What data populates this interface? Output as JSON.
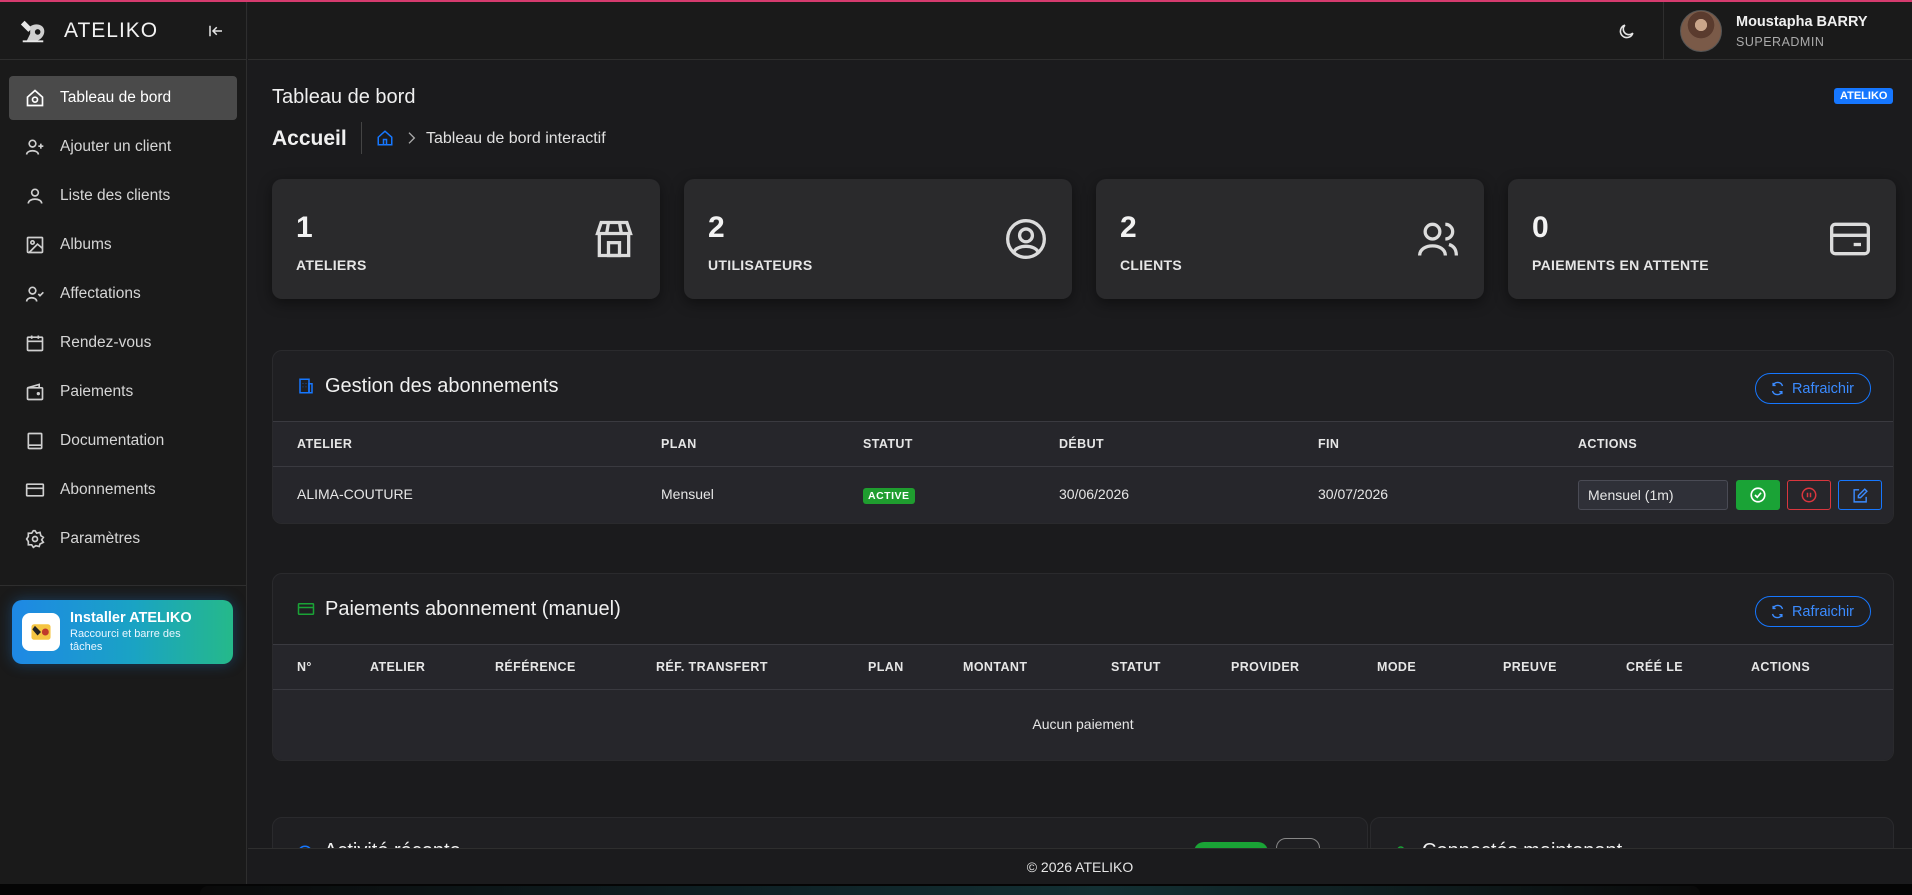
{
  "app": {
    "name": "ATELIKO"
  },
  "sidebar": {
    "items": [
      {
        "label": "Tableau de bord",
        "icon": "home-icon",
        "active": true
      },
      {
        "label": "Ajouter un client",
        "icon": "user-plus-icon"
      },
      {
        "label": "Liste des clients",
        "icon": "user-icon"
      },
      {
        "label": "Albums",
        "icon": "image-icon"
      },
      {
        "label": "Affectations",
        "icon": "user-check-icon"
      },
      {
        "label": "Rendez-vous",
        "icon": "calendar-icon"
      },
      {
        "label": "Paiements",
        "icon": "wallet-icon"
      },
      {
        "label": "Documentation",
        "icon": "book-icon"
      },
      {
        "label": "Abonnements",
        "icon": "credit-card-icon"
      },
      {
        "label": "Paramètres",
        "icon": "gear-icon"
      }
    ],
    "install": {
      "title": "Installer ATELIKO",
      "subtitle": "Raccourci et barre des tâches"
    }
  },
  "header": {
    "user": {
      "name": "Moustapha BARRY",
      "role": "SUPERADMIN"
    }
  },
  "page": {
    "title": "Tableau de bord",
    "badge": "ATELIKO",
    "breadcrumb": {
      "home": "Accueil",
      "current": "Tableau de bord interactif"
    }
  },
  "stats": [
    {
      "value": "1",
      "label": "ATELIERS",
      "icon": "store-icon"
    },
    {
      "value": "2",
      "label": "UTILISATEURS",
      "icon": "user-circle-icon"
    },
    {
      "value": "2",
      "label": "CLIENTS",
      "icon": "users-icon"
    },
    {
      "value": "0",
      "label": "PAIEMENTS EN ATTENTE",
      "icon": "credit-card-icon"
    }
  ],
  "subscriptions": {
    "title": "Gestion des abonnements",
    "refresh_label": "Rafraichir",
    "columns": [
      "ATELIER",
      "PLAN",
      "STATUT",
      "DÉBUT",
      "FIN",
      "ACTIONS"
    ],
    "rows": [
      {
        "atelier": "ALIMA-COUTURE",
        "plan": "Mensuel",
        "status": "ACTIVE",
        "start": "30/06/2026",
        "end": "30/07/2026",
        "plan_select": "Mensuel (1m)"
      }
    ]
  },
  "payments": {
    "title": "Paiements abonnement (manuel)",
    "refresh_label": "Rafraichir",
    "columns": [
      "N°",
      "ATELIER",
      "RÉFÉRENCE",
      "RÉF. TRANSFERT",
      "PLAN",
      "MONTANT",
      "STATUT",
      "PROVIDER",
      "MODE",
      "PREUVE",
      "CRÉÉ LE",
      "ACTIONS"
    ],
    "empty_text": "Aucun paiement"
  },
  "partial": {
    "left_title": "Activité récente",
    "right_title": "Connectés maintenant"
  },
  "footer": {
    "text": "© 2026 ATELIKO"
  },
  "colors": {
    "accent": "#1677ff",
    "success": "#1aa336",
    "danger": "#d9363e",
    "background": "#1b1b1d"
  }
}
